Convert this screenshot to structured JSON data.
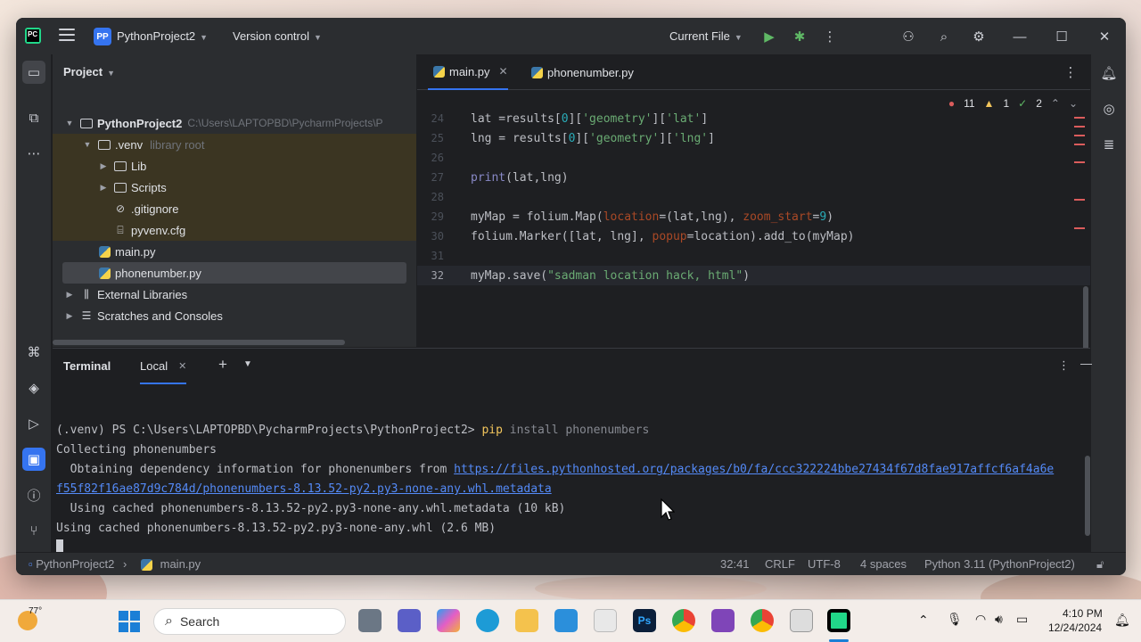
{
  "titlebar": {
    "project_badge": "PP",
    "project_name": "PythonProject2",
    "vcs": "Version control",
    "run_config": "Current File"
  },
  "project_panel": {
    "title": "Project",
    "tree": [
      {
        "label": "PythonProject2",
        "extra": "C:\\Users\\LAPTOPBD\\PycharmProjects\\P"
      },
      {
        "label": ".venv",
        "extra": "library root"
      },
      {
        "label": "Lib"
      },
      {
        "label": "Scripts"
      },
      {
        "label": ".gitignore"
      },
      {
        "label": "pyvenv.cfg"
      },
      {
        "label": "main.py"
      },
      {
        "label": "phonenumber.py"
      },
      {
        "label": "External Libraries"
      },
      {
        "label": "Scratches and Consoles"
      }
    ]
  },
  "editor": {
    "tabs": [
      {
        "label": "main.py",
        "active": true
      },
      {
        "label": "phonenumber.py",
        "active": false
      }
    ],
    "inspections": {
      "errors": "11",
      "warnings": "1",
      "ok": "2"
    },
    "lines": [
      {
        "no": "24",
        "text": "lat =results[0]['geometry']['lat']"
      },
      {
        "no": "25",
        "text": "lng = results[0]['geometry']['lng']"
      },
      {
        "no": "26",
        "text": ""
      },
      {
        "no": "27",
        "text": "print(lat,lng)"
      },
      {
        "no": "28",
        "text": ""
      },
      {
        "no": "29",
        "text": "myMap = folium.Map(location=(lat,lng), zoom_start=9)"
      },
      {
        "no": "30",
        "text": "folium.Marker([lat, lng], popup=location).add_to(myMap)"
      },
      {
        "no": "31",
        "text": ""
      },
      {
        "no": "32",
        "text": "myMap.save(\"sadman location hack, html\")"
      }
    ]
  },
  "terminal": {
    "title": "Terminal",
    "tab": "Local",
    "prompt": "(.venv) PS C:\\Users\\LAPTOPBD\\PycharmProjects\\PythonProject2> ",
    "cmd": "pip",
    "cmd_args": " install phonenumbers",
    "line2": "Collecting phonenumbers",
    "line3_prefix": "  Obtaining dependency information for phonenumbers from ",
    "line3_link": "https://files.pythonhosted.org/packages/b0/fa/ccc322224bbe27434f67d8fae917affcf6af4a6e",
    "line4_link": "f55f82f16ae87d9c784d/phonenumbers-8.13.52-py2.py3-none-any.whl.metadata",
    "line5": "  Using cached phonenumbers-8.13.52-py2.py3-none-any.whl.metadata (10 kB)",
    "line6": "Using cached phonenumbers-8.13.52-py2.py3-none-any.whl (2.6 MB)"
  },
  "statusbar": {
    "breadcrumb_project": "PythonProject2",
    "breadcrumb_file": "main.py",
    "position": "32:41",
    "line_sep": "CRLF",
    "encoding": "UTF-8",
    "indent": "4 spaces",
    "interpreter": "Python 3.11 (PythonProject2)"
  },
  "taskbar": {
    "weather": "77°",
    "search_placeholder": "Search",
    "time": "4:10 PM",
    "date": "12/24/2024"
  }
}
